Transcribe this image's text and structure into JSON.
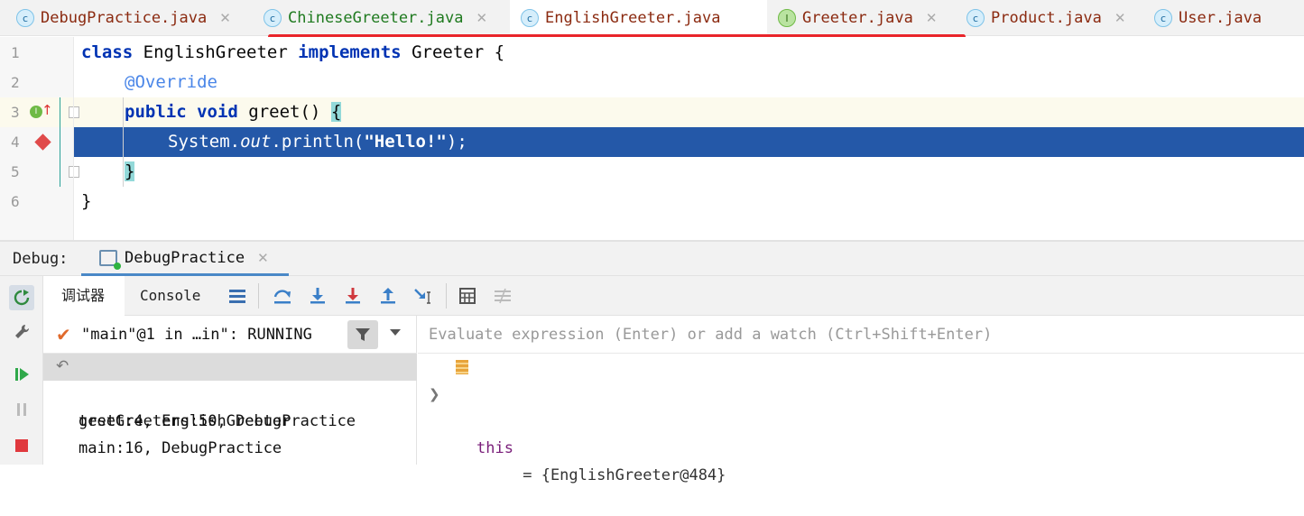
{
  "tabs": [
    {
      "label": "DebugPractice.java",
      "icon": "class-run-icon"
    },
    {
      "label": "ChineseGreeter.java",
      "icon": "class-icon"
    },
    {
      "label": "EnglishGreeter.java",
      "icon": "class-icon"
    },
    {
      "label": "Greeter.java",
      "icon": "interface-icon"
    },
    {
      "label": "Product.java",
      "icon": "class-icon"
    },
    {
      "label": "User.java",
      "icon": "class-icon"
    }
  ],
  "editor": {
    "line_numbers": [
      "1",
      "2",
      "3",
      "4",
      "5",
      "6"
    ],
    "line1": {
      "kw1": "class",
      "name": " EnglishGreeter ",
      "kw2": "implements",
      "rest": " Greeter {"
    },
    "line2": {
      "annotation": "@Override"
    },
    "line3": {
      "kw1": "public",
      "kw2": "void",
      "method": " greet() ",
      "brace": "{"
    },
    "line4": {
      "pre": "System.",
      "field": "out",
      "mid": ".println(",
      "string": "\"Hello!\"",
      "post": ");"
    },
    "line5": {
      "brace": "}"
    },
    "line6": {
      "text": "}"
    }
  },
  "debug": {
    "label": "Debug:",
    "session_tab": "DebugPractice",
    "tabs": [
      "调试器",
      "Console"
    ],
    "thread": "\"main\"@1 in …in\": RUNNING",
    "frames": [
      "greet:4, EnglishGreeter",
      "testGreeters:50, DebugPractice",
      "main:16, DebugPractice"
    ],
    "watch_placeholder": "Evaluate expression (Enter) or add a watch (Ctrl+Shift+Enter)",
    "variable": {
      "name": "this",
      "value": " = {EnglishGreeter@484}"
    }
  },
  "colors": {
    "keyword": "#0033b3",
    "annotation": "#4a86e8",
    "selection": "#2458a8",
    "tab_underline": "#e9242a",
    "breakpoint": "#e04a4a"
  }
}
